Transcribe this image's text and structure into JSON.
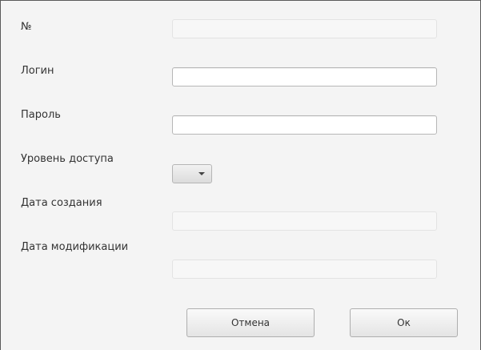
{
  "form": {
    "id_label": "№",
    "id_value": "",
    "login_label": "Логин",
    "login_value": "",
    "password_label": "Пароль",
    "password_value": "",
    "access_level_label": "Уровень доступа",
    "access_level_value": "",
    "created_label": "Дата создания",
    "created_value": "",
    "modified_label": "Дата модификации",
    "modified_value": ""
  },
  "buttons": {
    "cancel_label": "Отмена",
    "ok_label": "Ок"
  },
  "icons": {
    "combo_arrow": "chevron-down-icon"
  },
  "colors": {
    "background": "#f4f4f4",
    "text": "#333333",
    "readonly_field": "#f7f7f7",
    "editable_field": "#ffffff"
  }
}
